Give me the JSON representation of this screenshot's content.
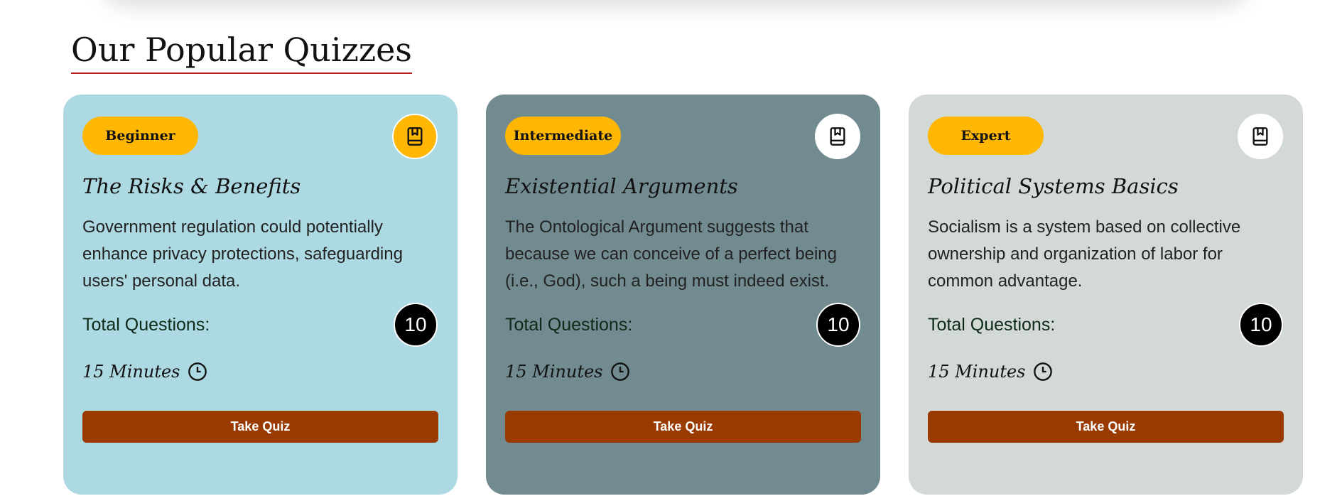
{
  "section": {
    "title": "Our Popular Quizzes"
  },
  "colors": {
    "accent_badge": "#ffb703",
    "button": "#993a00",
    "card_1": "#add9e3",
    "card_2": "#728b90",
    "card_3": "#d3d9d6",
    "title_underline": "#b41e1e"
  },
  "cards": [
    {
      "level": "Beginner",
      "title": "The Risks & Benefits",
      "description": "Government regulation could potentially enhance privacy protections, safeguarding users' personal data.",
      "total_label": "Total Questions:",
      "total_count": "10",
      "duration": "15 Minutes",
      "button_label": "Take Quiz",
      "icon": "book-bookmark-icon"
    },
    {
      "level": "Intermediate",
      "title": "Existential Arguments",
      "description": "The Ontological Argument suggests that because we can conceive of a perfect being (i.e., God), such a being must indeed exist.",
      "total_label": "Total Questions:",
      "total_count": "10",
      "duration": "15 Minutes",
      "button_label": "Take Quiz",
      "icon": "book-bookmark-icon"
    },
    {
      "level": "Expert",
      "title": "Political Systems Basics",
      "description": "Socialism is a system based on collective ownership and organization of labor for common advantage.",
      "total_label": "Total Questions:",
      "total_count": "10",
      "duration": "15 Minutes",
      "button_label": "Take Quiz",
      "icon": "book-bookmark-icon"
    }
  ]
}
